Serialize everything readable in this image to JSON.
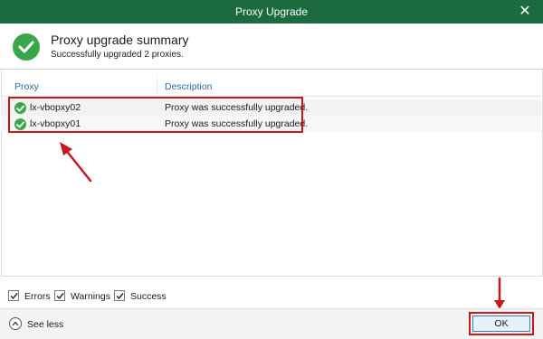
{
  "window": {
    "title": "Proxy Upgrade",
    "close_icon": "close-icon"
  },
  "header": {
    "title": "Proxy upgrade summary",
    "subtitle": "Successfully upgraded 2 proxies.",
    "icon": "success-check-icon",
    "accent_color": "#3aa64a"
  },
  "table": {
    "columns": [
      "Proxy",
      "Description"
    ],
    "rows": [
      {
        "proxy": "lx-vbopxy02",
        "description": "Proxy was successfully upgraded.",
        "status_icon": "success-check-icon"
      },
      {
        "proxy": "lx-vbopxy01",
        "description": "Proxy was successfully upgraded.",
        "status_icon": "success-check-icon"
      }
    ]
  },
  "filters": [
    {
      "label": "Errors",
      "checked": true
    },
    {
      "label": "Warnings",
      "checked": true
    },
    {
      "label": "Success",
      "checked": true
    }
  ],
  "footer": {
    "see_less_label": "See less",
    "ok_label": "OK"
  },
  "colors": {
    "titlebar": "#1c6b3f",
    "highlight_annotation": "#c8181e",
    "link_header": "#2b6aa6"
  }
}
